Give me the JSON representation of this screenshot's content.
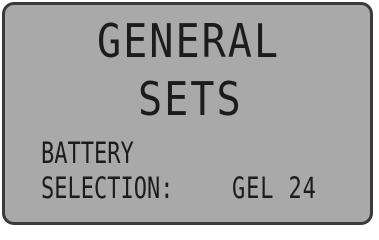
{
  "screen": {
    "title_line1": "GENERAL",
    "title_line2": "SETS",
    "setting_label_line1": "BATTERY",
    "setting_label_line2": "SELECTION:",
    "setting_value": "GEL 24"
  },
  "colors": {
    "lcd_background": "#a9a9a9",
    "segment_text": "#1c1c1c",
    "bezel": "#3a3a3a"
  }
}
